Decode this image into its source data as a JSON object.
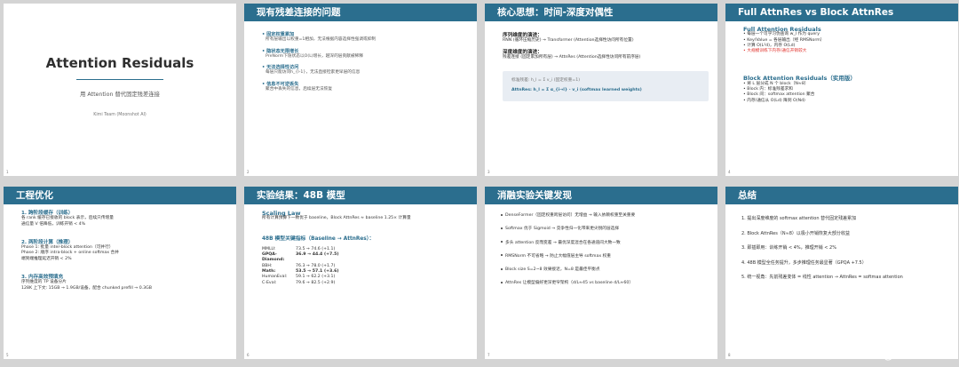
{
  "slides": [
    {
      "number": "1",
      "title": "Attention Residuals",
      "subtitle": "用 Attention 替代固定残差连接",
      "author": "Kimi Team (Moonshot AI)"
    },
    {
      "number": "2",
      "header": "现有残差连接的问题",
      "items": [
        {
          "head": "• 固定权重累加",
          "sub": "所有层输出以权重=1相加，无法根据内容选择性强调或抑制"
        },
        {
          "head": "• 隐状态无限增长",
          "sub": "PreNorm下隐状态以O(L)增长，越深的层贡献被稀释"
        },
        {
          "head": "• 无法选择性访问",
          "sub": "每层只能访问h_{l-1}，无法直接检索更早层的信息"
        },
        {
          "head": "• 信息不可逆丢失",
          "sub": "聚合中丢失的信息，后续层无法恢复"
        }
      ]
    },
    {
      "number": "3",
      "header": "核心思想：时间-深度对偶性",
      "sec1_title": "序列维度的演进：",
      "sec1_text": "RNN (循环压缩历史) → Transformer (Attention选择性访问所有位置)",
      "sec2_title": "深度维度的演进：",
      "sec2_text": "残差连接 (固定累加所有层) → AttnRes (Attention选择性访问所有前序层)",
      "box_label": "标准残差:  h_l = Σ v_i   (固定权重=1)",
      "box_formula": "AttnRes:     h_l = Σ α_{i→l} · v_i     (softmax learned weights)"
    },
    {
      "number": "4",
      "header": "Full AttnRes vs Block AttnRes",
      "full_title": "Full Attention Residuals",
      "full_items": [
        "• 每层一个可学习伪查询 w_l 作为 query",
        "• Key/Value = 各层输出（经 RMSNorm）",
        "• 计算 O(L²d)，内存 O(Ld)"
      ],
      "full_warn": "• 大规模训练下内存/通信开销较大",
      "block_title": "Block Attention Residuals（实用版）",
      "block_items": [
        "• 将 L 层分成 N 个 block（N≈8）",
        "• Block 内：标准残差求和",
        "• Block 间：softmax attention 聚合",
        "• 内存/通信从 O(Ld) 降到 O(Nd)"
      ]
    },
    {
      "number": "5",
      "header": "工程优化",
      "groups": [
        {
          "head": "1. 跨阶段缓存（训练）",
          "lines": [
            "各 rank 缓存已接收的 block 表示，后续只传增量",
            "通信量 V 倍降低，训练开销 < 4%"
          ]
        },
        {
          "head": "2. 两阶段计算（推理）",
          "lines": [
            "Phase 1: 批量 inter-block attention（可并行）",
            "Phase 2: 顺序 intra-block + online softmax 合并",
            "端到端推理延迟开销 < 2%"
          ]
        },
        {
          "head": "3. 内存高效预填充",
          "lines": [
            "序列维度的 TP 设备分片",
            "128K 上下文: 15GB → 1.9GB/设备，配合 chunked prefill → 0.3GB"
          ]
        }
      ]
    },
    {
      "number": "6",
      "header": "实验结果：48B 模型",
      "law_title": "Scaling Law",
      "law_text": "所有计算预算下一致优于 baseline，Block AttnRes ≈ baseline 1.25× 计算量",
      "metrics_title": "48B 模型关键指标（Baseline → AttnRes）：",
      "metrics": [
        {
          "k": "MMLU:",
          "v": "73.5 → 74.6 (+1.1)",
          "bold": false
        },
        {
          "k": "GPQA-Diamond:",
          "v": "36.9 → 44.4 (+7.5)",
          "bold": true
        },
        {
          "k": "BBH:",
          "v": "76.3 → 78.0 (+1.7)",
          "bold": false
        },
        {
          "k": "Math:",
          "v": "53.5 → 57.1 (+3.6)",
          "bold": true
        },
        {
          "k": "HumanEval:",
          "v": "59.1 → 62.2 (+3.1)",
          "bold": false
        },
        {
          "k": "C-Eval:",
          "v": "79.6 → 82.5 (+2.9)",
          "bold": false
        }
      ]
    },
    {
      "number": "7",
      "header": "消融实验关键发现",
      "items": [
        "DenseFormer（固定权重跨层访问）无增益 → 输入依赖权重至关重要",
        "Softmax 优于 Sigmoid → 竞争性归一化带来更尖锐的层选择",
        "多头 attention 反而变差 → 最优深度混合在各通道间大致一致",
        "RMSNorm 不可省略 → 防止大幅值层主导 softmax 权重",
        "Block size S=2~8 效果接近，N=8 是最佳平衡点",
        "AttnRes 让模型偏好更深更窄架构（d/L≈45 vs baseline d/L≈60）"
      ]
    },
    {
      "number": "8",
      "header": "总结",
      "items": [
        "1. 提出深度维度的 softmax attention 替代固定残差累加",
        "2. Block AttnRes（N≈8）以极小开销恢复大部分收益",
        "3. 即插即用：训练开销 < 4%，推理开销 < 2%",
        "4. 48B 模型全任务提升，多步推理任务最显著（GPQA +7.5）",
        "5. 统一视角：先前残差变体 = 线性 attention → AttnRes = softmax attention"
      ]
    }
  ],
  "watermark": "CSDN @undefined"
}
